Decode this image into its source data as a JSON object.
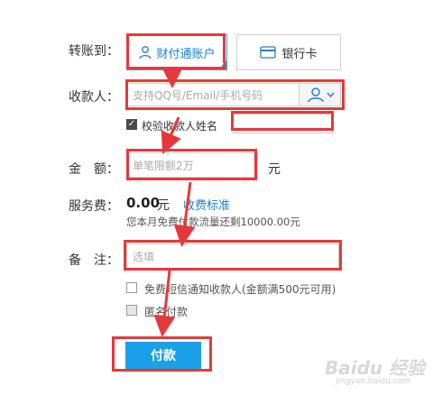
{
  "form": {
    "transfer_to_label": "转账到：",
    "tab_tenpay": "财付通账户",
    "tab_bank": "银行卡",
    "payee_label": "收款人：",
    "payee_placeholder": "支持QQ号/Email/手机号码",
    "verify_name_label": "校验收款人姓名",
    "amount_label": "金　额：",
    "amount_placeholder": "单笔限额2万",
    "amount_unit": "元",
    "fee_label": "服务费：",
    "fee_value": "0.00",
    "fee_unit": "元",
    "fee_link": "收费标准",
    "fee_note": "您本月免费付款流量还剩10000.00元",
    "remark_label": "备　注：",
    "remark_placeholder": "选填",
    "sms_notify_label": "免费短信通知收款人(金额满500元可用)",
    "anonymous_label": "匿名付款",
    "submit_label": "付款"
  },
  "watermark": {
    "text": "Baidu 经验",
    "sub": "jingyan.baidu.com"
  },
  "colors": {
    "accent": "#1aa0e6",
    "annotation": "#e6383c",
    "selected_tab": "#3a9de0"
  },
  "icons": [
    "user-icon",
    "card-icon",
    "contact-picker-icon",
    "chevron-down-icon",
    "check-icon",
    "arrow-down-icon"
  ]
}
